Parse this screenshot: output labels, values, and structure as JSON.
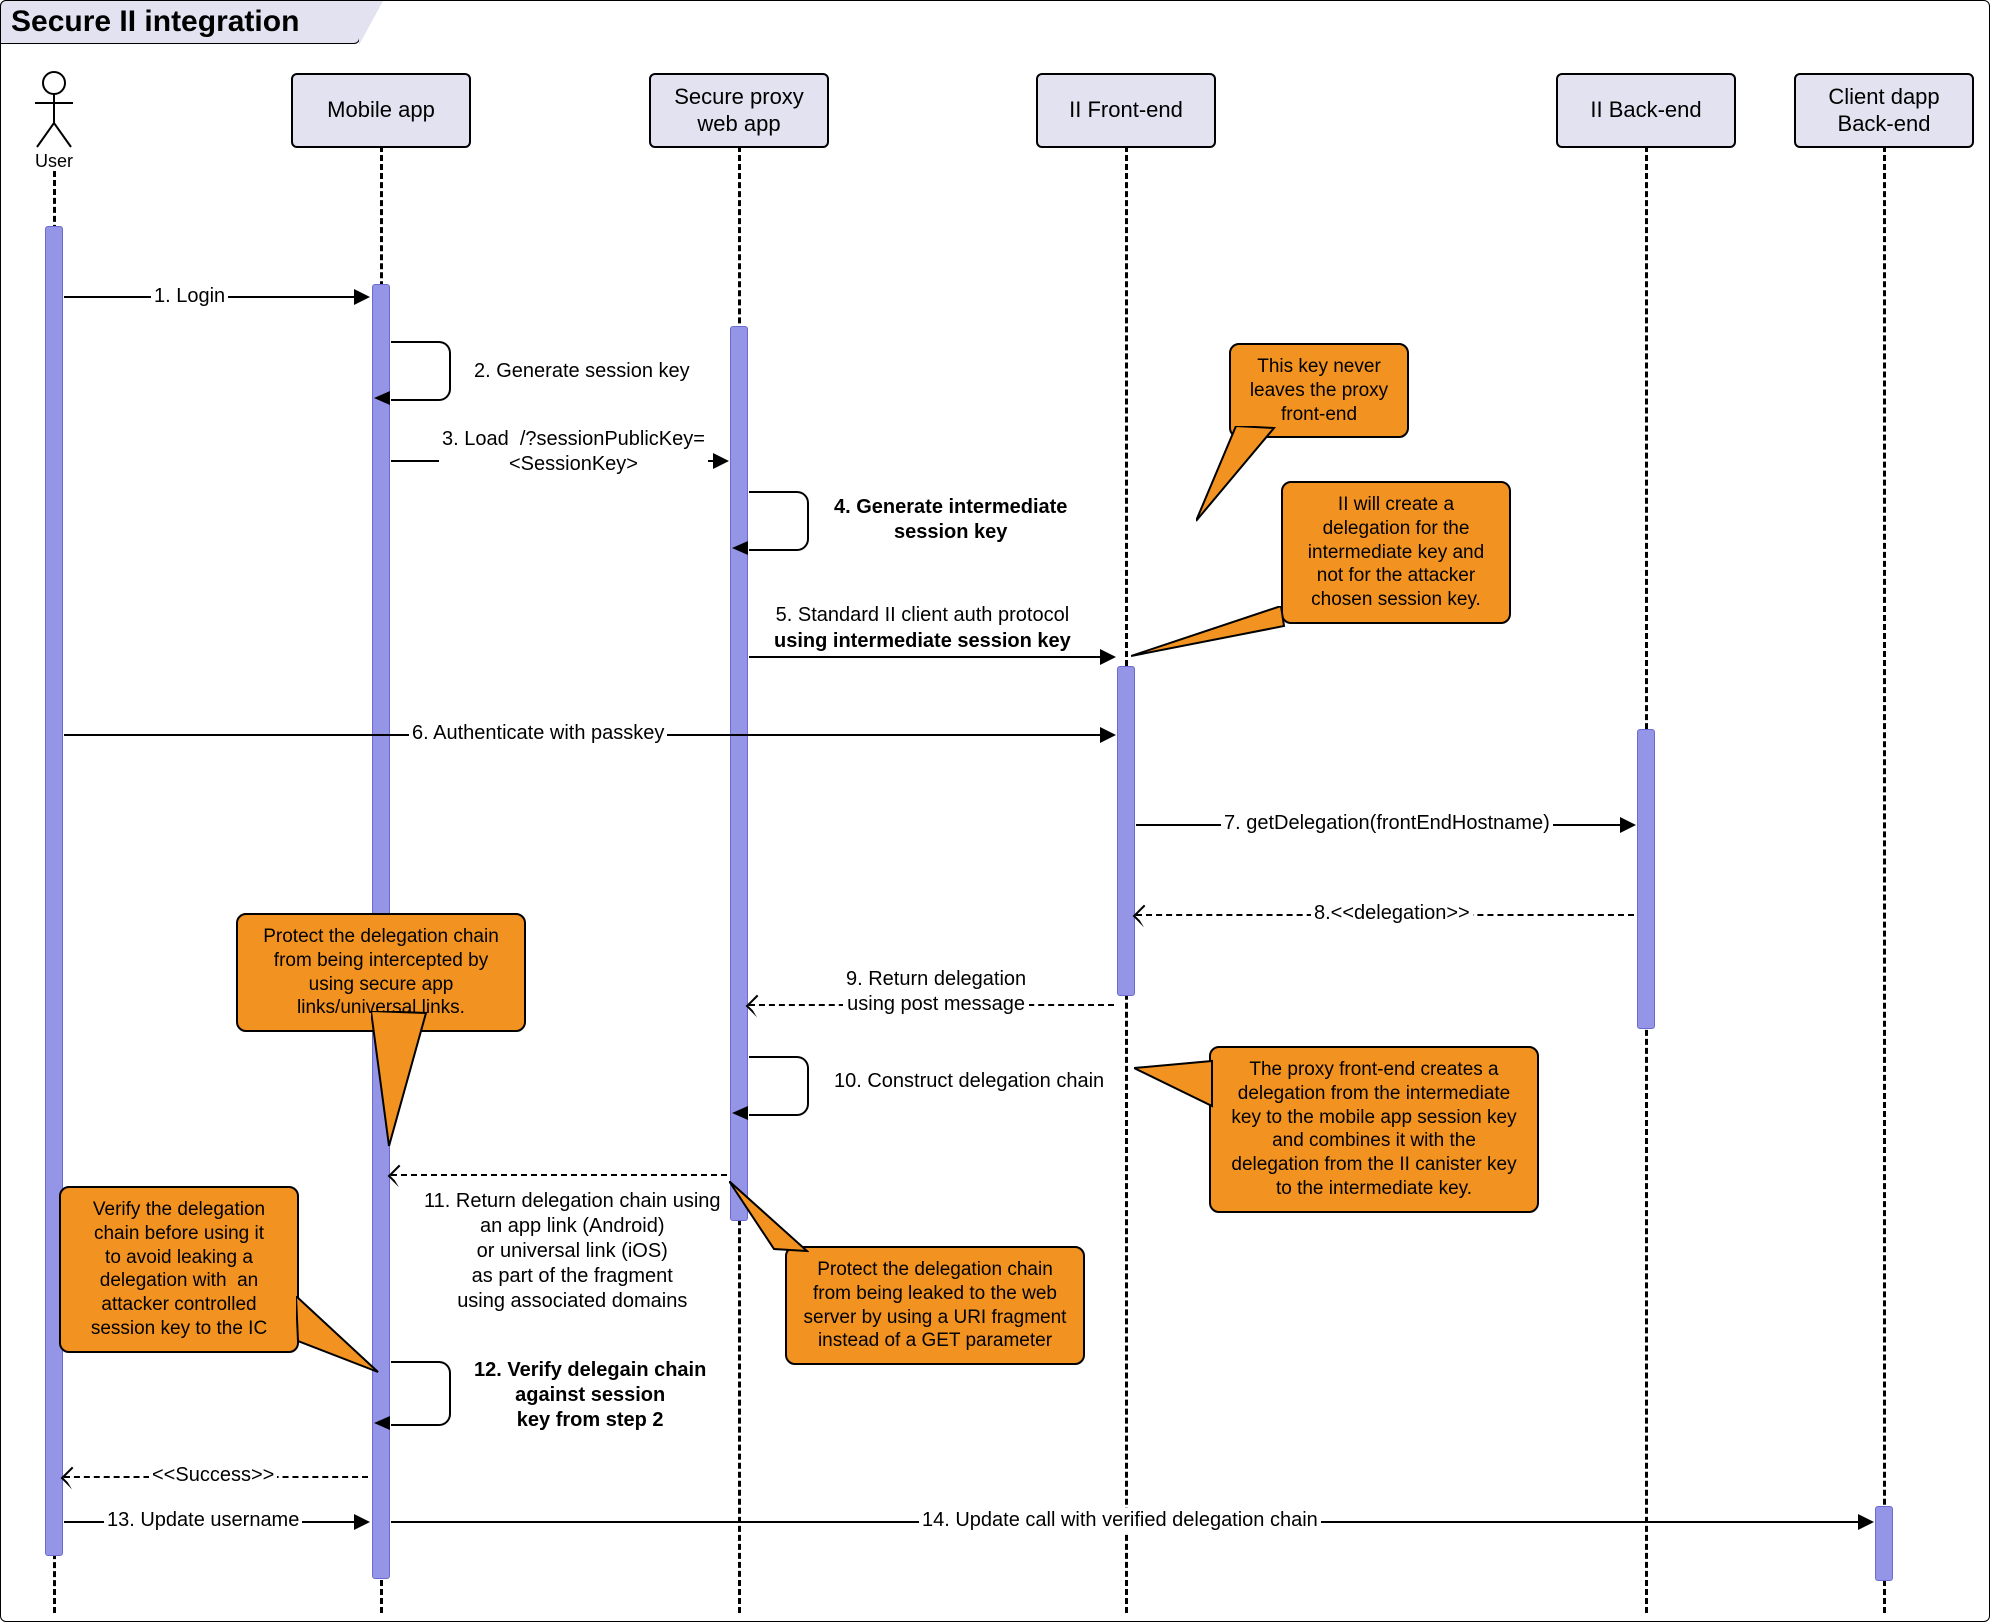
{
  "title": "Secure II integration",
  "actors": {
    "user": "User",
    "mobile": "Mobile app",
    "proxy": "Secure proxy\nweb app",
    "iife": "II Front-end",
    "iibe": "II Back-end",
    "dapp": "Client dapp\nBack-end"
  },
  "messages": {
    "m1": "1. Login",
    "m2": "2. Generate session key",
    "m3": "3. Load  /?sessionPublicKey=\n<SessionKey>",
    "m4": "4. Generate intermediate\nsession key",
    "m5a": "5. Standard II client auth protocol",
    "m5b": "using intermediate session key ",
    "m6": "6. Authenticate with passkey",
    "m7": "7. getDelegation(frontEndHostname)",
    "m8": "8.<<delegation>>",
    "m9": "9. Return delegation\nusing post message",
    "m10": "10. Construct delegation chain",
    "m11": "11. Return delegation chain using\nan app link (Android)\nor universal link (iOS)\nas part of the fragment\nusing associated domains",
    "m12": "12. Verify delegain chain\nagainst session\nkey from step 2",
    "success": "<<Success>>",
    "m13": "13. Update username",
    "m14": "14. Update call with verified delegation chain"
  },
  "notes": {
    "n1": "This key never\nleaves the proxy\nfront-end",
    "n2": "II will create a\ndelegation for the\nintermediate key and\nnot for the attacker\nchosen session key.",
    "n3": "The proxy front-end creates a\ndelegation from the intermediate\nkey to the mobile app session key\nand combines it with the\ndelegation from the II canister key\nto the intermediate key.",
    "n4": "Protect the delegation chain\nfrom being leaked to the web\nserver by using a URI fragment\ninstead of a GET parameter",
    "n5": "Protect the delegation chain\nfrom being intercepted by\nusing secure app\nlinks/universal links.",
    "n6": "Verify the delegation\nchain before using it\nto avoid leaking a\ndelegation with  an\nattacker controlled\nsession key to the IC"
  }
}
